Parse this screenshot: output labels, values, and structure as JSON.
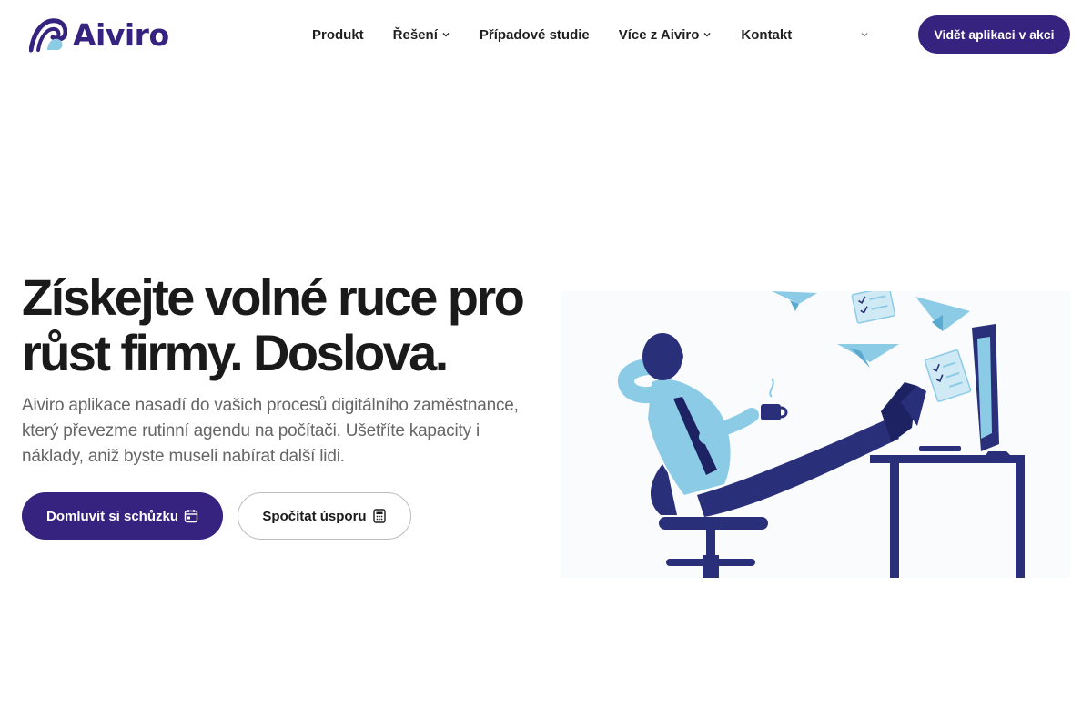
{
  "brand": {
    "name": "Aiviro",
    "color": "#35237f",
    "accent_light": "#7fc4e3"
  },
  "nav": {
    "items": [
      {
        "label": "Produkt",
        "has_dropdown": false
      },
      {
        "label": "Řešení",
        "has_dropdown": true
      },
      {
        "label": "Případové studie",
        "has_dropdown": false
      },
      {
        "label": "Více z Aiviro",
        "has_dropdown": true
      },
      {
        "label": "Kontakt",
        "has_dropdown": false
      }
    ],
    "language_flag": "󠁧󠁢",
    "cta_label": "Vidět aplikaci v akci"
  },
  "hero": {
    "title": "Získejte volné ruce pro růst firmy. Doslova.",
    "subtitle": "Aiviro aplikace nasadí do vašich procesů digitálního zaměstnance, který převezme rutinní agendu na počítači. Ušetříte kapacity i náklady, aniž byste museli nabírat další lidi.",
    "primary_button": "Domluvit si schůzku",
    "secondary_button": "Spočítat úsporu",
    "primary_icon": "calendar-icon",
    "secondary_icon": "calculator-icon"
  },
  "colors": {
    "heading": "#1a1a1a",
    "body": "#666666",
    "illustration_navy": "#2a2f7a",
    "illustration_blue": "#8ccbe6"
  }
}
